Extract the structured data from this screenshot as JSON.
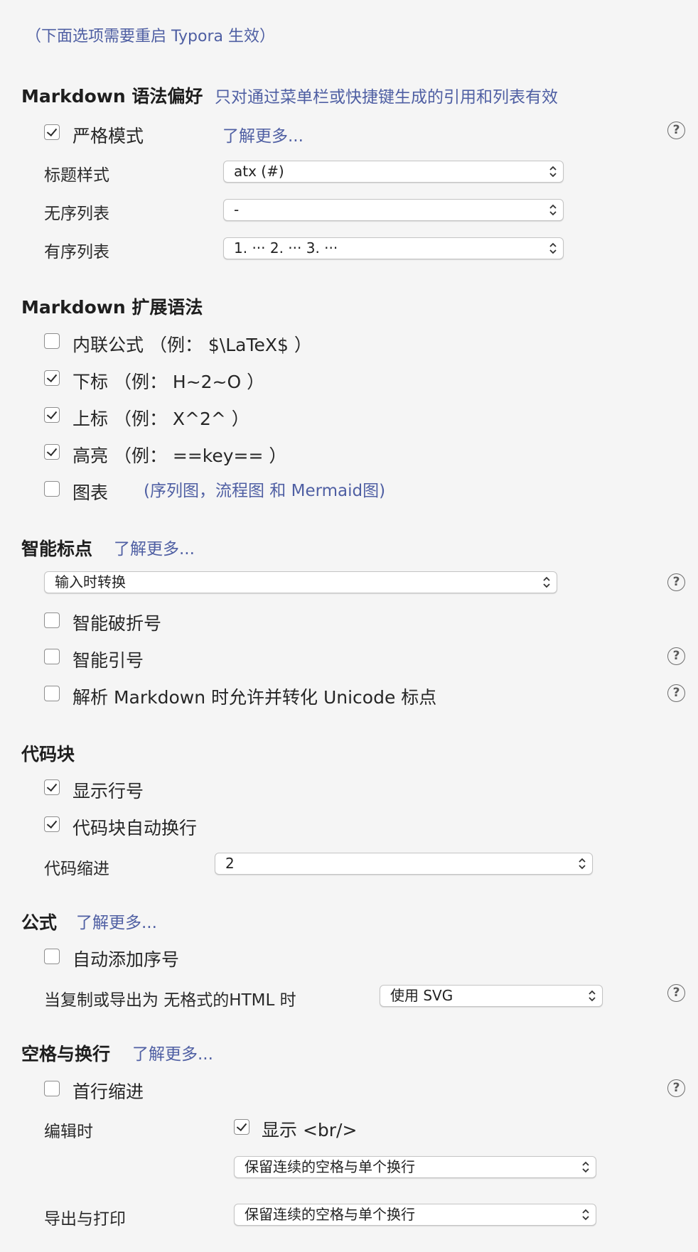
{
  "restart_note": "（下面选项需要重启 Typora 生效）",
  "md_pref": {
    "heading": "Markdown 语法偏好",
    "note": "只对通过菜单栏或快捷键生成的引用和列表有效",
    "strict_mode": {
      "label": "严格模式",
      "checked": true
    },
    "learn_more": "了解更多...",
    "heading_style": {
      "label": "标题样式",
      "value": "atx (#)"
    },
    "unordered_list": {
      "label": "无序列表",
      "value": "-"
    },
    "ordered_list": {
      "label": "有序列表",
      "value": "1. ··· 2. ··· 3. ···"
    }
  },
  "md_ext": {
    "heading": "Markdown 扩展语法",
    "items": [
      {
        "label": "内联公式 （例： $\\LaTeX$ ）",
        "checked": false
      },
      {
        "label": "下标 （例： H~2~O ）",
        "checked": true
      },
      {
        "label": "上标 （例： X^2^ ）",
        "checked": true
      },
      {
        "label": "高亮 （例： ==key== ）",
        "checked": true
      },
      {
        "label": "图表",
        "checked": false
      }
    ],
    "diagram_note": "(序列图，流程图 和 Mermaid图)"
  },
  "smart_punct": {
    "heading": "智能标点",
    "learn_more": "了解更多...",
    "mode": "输入时转换",
    "items": [
      {
        "label": "智能破折号",
        "checked": false
      },
      {
        "label": "智能引号",
        "checked": false
      },
      {
        "label": "解析 Markdown 时允许并转化 Unicode 标点",
        "checked": false
      }
    ]
  },
  "code_block": {
    "heading": "代码块",
    "items": [
      {
        "label": "显示行号",
        "checked": true
      },
      {
        "label": "代码块自动换行",
        "checked": true
      }
    ],
    "indent": {
      "label": "代码缩进",
      "value": "2"
    }
  },
  "math": {
    "heading": "公式",
    "learn_more": "了解更多...",
    "auto_number": {
      "label": "自动添加序号",
      "checked": false
    },
    "export_label": "当复制或导出为 无格式的HTML 时",
    "export_value": "使用 SVG"
  },
  "whitespace": {
    "heading": "空格与换行",
    "learn_more": "了解更多...",
    "first_indent": {
      "label": "首行缩进",
      "checked": false
    },
    "edit_label": "编辑时",
    "show_br": {
      "label": "显示 <br/>",
      "checked": true
    },
    "edit_value": "保留连续的空格与单个换行",
    "export_label": "导出与打印",
    "export_value": "保留连续的空格与单个换行"
  },
  "help_glyph": "?",
  "icons": {
    "help": "question-circle-icon",
    "select_arrows": "chevron-up-down-icon",
    "checkbox_check": "checkmark-icon"
  }
}
